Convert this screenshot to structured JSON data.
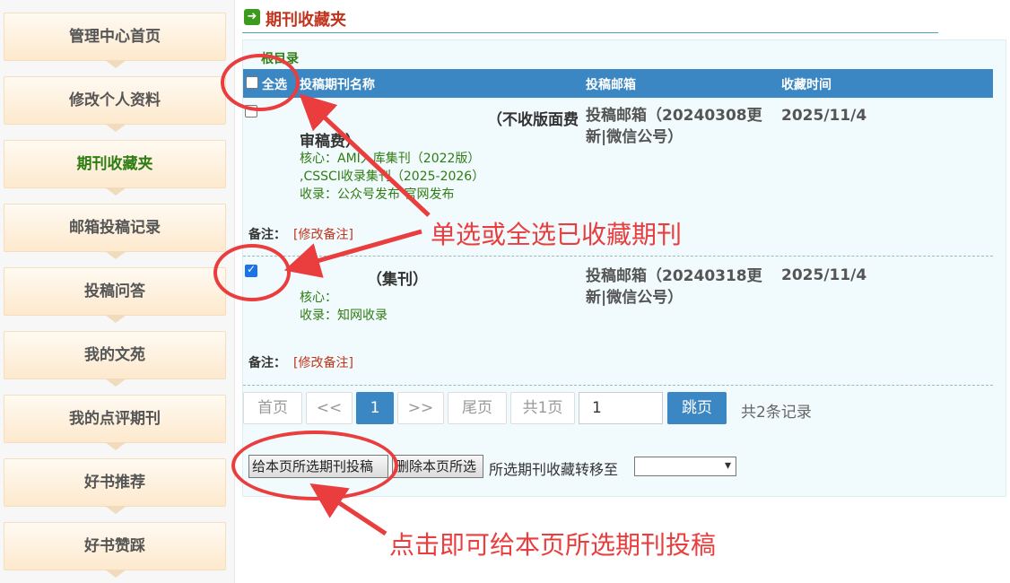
{
  "sidebar": {
    "items": [
      {
        "label": "管理中心首页",
        "active": false
      },
      {
        "label": "修改个人资料",
        "active": false
      },
      {
        "label": "期刊收藏夹",
        "active": true
      },
      {
        "label": "邮箱投稿记录",
        "active": false
      },
      {
        "label": "投稿问答",
        "active": false
      },
      {
        "label": "我的文苑",
        "active": false
      },
      {
        "label": "我的点评期刊",
        "active": false
      },
      {
        "label": "好书推荐",
        "active": false
      },
      {
        "label": "好书赞踩",
        "active": false
      }
    ]
  },
  "page": {
    "title": "期刊收藏夹",
    "subtitle": "根目录"
  },
  "table": {
    "select_all": "全选",
    "col_name": "投稿期刊名称",
    "col_email": "投稿邮箱",
    "col_time": "收藏时间",
    "rows": [
      {
        "checked": false,
        "name_tail": "（不收版面费",
        "name_line2": "审稿费）",
        "tags": [
          "核心：AMI入库集刊（2022版）",
          ",CSSCI收录集刊（2025-2026）",
          "收录：公众号发布  官网发布"
        ],
        "email": "投稿邮箱（20240308更新|微信公号）",
        "time": "2025/11/4",
        "note_label": "备注：",
        "note_link": "[修改备注]"
      },
      {
        "checked": true,
        "name_tail": "（集刊）",
        "name_line2": "",
        "tags": [
          "核心：",
          "收录：知网收录"
        ],
        "email": "投稿邮箱（20240318更新|微信公号）",
        "time": "2025/11/4",
        "note_label": "备注：",
        "note_link": "[修改备注]"
      }
    ]
  },
  "pagination": {
    "first": "首页",
    "prev": "<<",
    "current": "1",
    "next": ">>",
    "last": "尾页",
    "total_pages": "共1页",
    "page_input": "1",
    "jump": "跳页",
    "total_records": "共2条记录"
  },
  "actions": {
    "submit_selected": "给本页所选期刊投稿",
    "delete_selected": "删除本页所选",
    "move_label": "所选期刊收藏转移至"
  },
  "annotations": {
    "select_hint": "单选或全选已收藏期刊",
    "submit_hint": "点击即可给本页所选期刊投稿",
    "color": "#ea3d3d"
  }
}
